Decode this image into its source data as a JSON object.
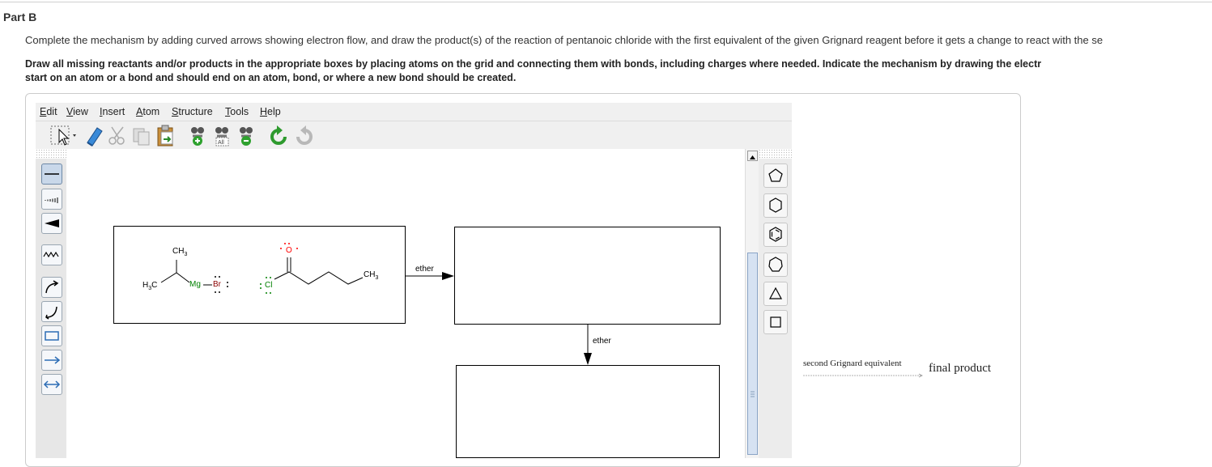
{
  "part": {
    "title": "Part B"
  },
  "instructions": {
    "line1": "Complete the mechanism by adding curved arrows showing electron flow, and draw the product(s) of the reaction of pentanoic chloride with the first equivalent of the given Grignard reagent before it gets a change to react with the se",
    "line2a": "Draw all missing reactants and/or products in the appropriate boxes by placing atoms on the grid and connecting them with bonds, including charges where needed. Indicate the mechanism by drawing the electr",
    "line2b": "start on an atom or a bond and should end on an atom, bond, or where a new bond should be created."
  },
  "menubar": {
    "items": [
      {
        "label": "Edit",
        "underline": "E",
        "rest": "dit"
      },
      {
        "label": "View",
        "underline": "V",
        "rest": "iew"
      },
      {
        "label": "Insert",
        "underline": "I",
        "rest": "nsert"
      },
      {
        "label": "Atom",
        "underline": "A",
        "rest": "tom"
      },
      {
        "label": "Structure",
        "underline": "S",
        "rest": "tructure"
      },
      {
        "label": "Tools",
        "underline": "T",
        "rest": "ools"
      },
      {
        "label": "Help",
        "underline": "H",
        "rest": "elp"
      }
    ]
  },
  "toolbar": {
    "icons": [
      "select-arrow-icon",
      "eraser-icon",
      "cut-icon",
      "copy-icon",
      "paste-icon",
      "zoom-in-icon",
      "zoom-fit-icon",
      "zoom-out-icon",
      "undo-icon",
      "redo-icon"
    ]
  },
  "left_tools": {
    "icons": [
      "single-bond-icon",
      "hashed-bond-icon",
      "wedge-bond-icon",
      "wavy-bond-icon",
      "curved-arrow-single-icon",
      "curved-arrow-double-icon",
      "rectangle-box-icon",
      "reaction-arrow-icon",
      "double-arrow-icon"
    ],
    "active": "single-bond-icon"
  },
  "right_tools": {
    "icons": [
      "cyclopentane-icon",
      "cyclohexane-icon",
      "benzene-icon",
      "cycloheptane-icon",
      "cyclopropane-icon",
      "cyclobutane-icon"
    ]
  },
  "reaction": {
    "reactants": {
      "ch3_top": "CH",
      "ch3_top_sub": "3",
      "h3c": "H",
      "h3c_sub": "3",
      "h3c_c": "C",
      "mg": "Mg",
      "br": "Br",
      "o": "O",
      "cl": "Cl",
      "ch3_chain": "CH",
      "ch3_chain_sub": "3"
    },
    "arrow1_label": "ether",
    "arrow2_label": "ether"
  },
  "side_legend": {
    "arrow_label": "second Grignard equivalent",
    "result": "final product"
  },
  "colors": {
    "mg": "#008000",
    "br": "#8b0000",
    "o": "#ff0000",
    "cl": "#008000",
    "accent": "#2d6db5"
  }
}
